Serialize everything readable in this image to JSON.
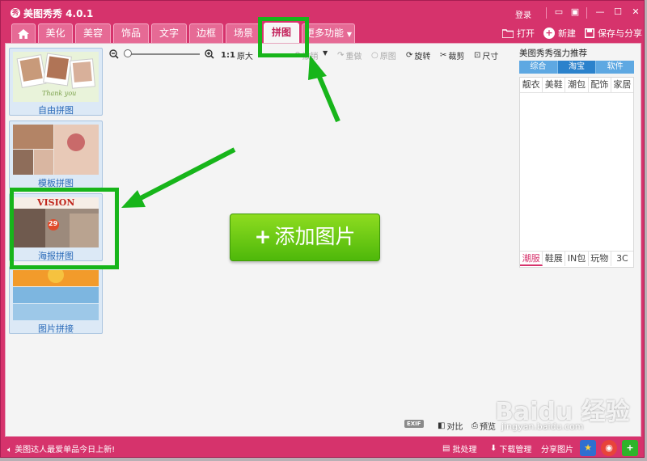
{
  "window": {
    "title": "美图秀秀 4.0.1",
    "logo": "秀",
    "login": "登录"
  },
  "tabs": [
    {
      "label": "美化"
    },
    {
      "label": "美容"
    },
    {
      "label": "饰品"
    },
    {
      "label": "文字"
    },
    {
      "label": "边框"
    },
    {
      "label": "场景"
    },
    {
      "label": "拼图"
    },
    {
      "label": "更多功能"
    }
  ],
  "active_tab": "拼图",
  "top_actions": {
    "open": "打开",
    "new": "新建",
    "save_share": "保存与分享"
  },
  "puzzle_modes": [
    {
      "label": "自由拼图",
      "thumb_text": "Thank you"
    },
    {
      "label": "模板拼图"
    },
    {
      "label": "海报拼图",
      "thumb_title": "VISION",
      "thumb_number": "29"
    },
    {
      "label": "图片拼接"
    }
  ],
  "toolbar": {
    "zoom_ratio": "1:1",
    "original_size": "原大",
    "undo": "撤销",
    "redo": "重做",
    "original": "原图",
    "rotate": "旋转",
    "crop": "裁剪",
    "size": "尺寸"
  },
  "add_button": {
    "plus": "+",
    "label": "添加图片"
  },
  "recommend": {
    "title": "美图秀秀强力推荐",
    "tabs": [
      "综合",
      "淘宝",
      "软件"
    ],
    "active_tab": "淘宝",
    "top_categories": [
      "靓衣",
      "美鞋",
      "潮包",
      "配饰",
      "家居"
    ],
    "bottom_categories": [
      "潮服",
      "鞋展",
      "IN包",
      "玩物",
      "3C"
    ],
    "active_bottom": "潮服"
  },
  "bottom_tools": {
    "exif": "EXIF",
    "compare": "对比",
    "preview": "预览"
  },
  "statusbar": {
    "message": "美图达人最爱单品今日上新!",
    "batch": "批处理",
    "download": "下载管理",
    "share": "分享图片"
  },
  "watermark": {
    "main": "Baidu 经验",
    "sub": "jingyan.baidu.com"
  },
  "colors": {
    "brand": "#d6336c",
    "accent_green": "#17b51a",
    "button_green": "#5cc012",
    "tab_blue": "#2b82cc"
  }
}
